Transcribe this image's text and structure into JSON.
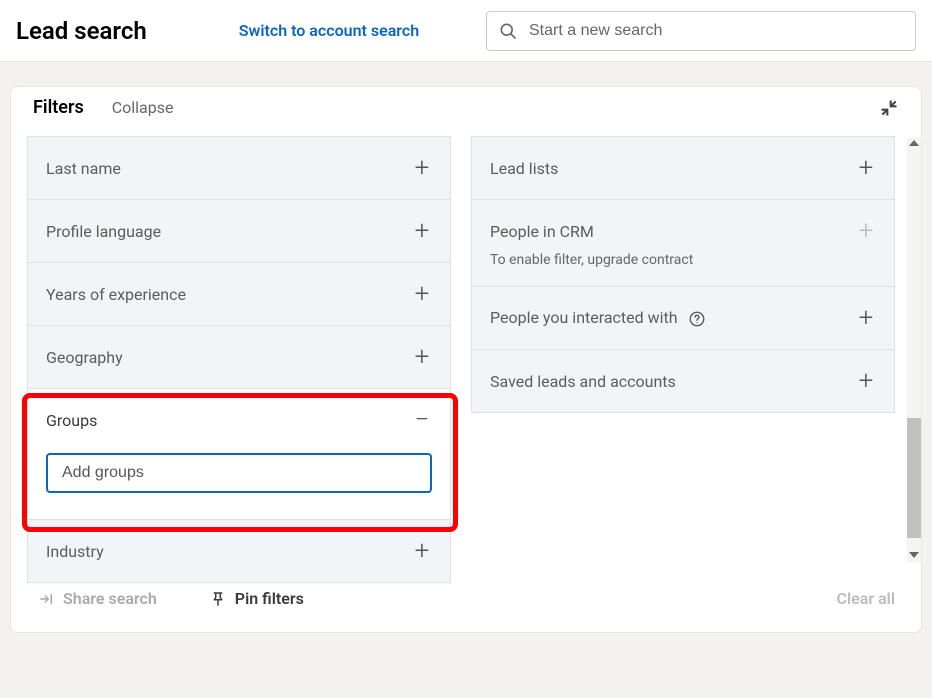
{
  "header": {
    "title": "Lead search",
    "switch_link": "Switch to account search",
    "search_placeholder": "Start a new search"
  },
  "filters_panel": {
    "title": "Filters",
    "collapse_label": "Collapse"
  },
  "left_filters": {
    "last_name": "Last name",
    "profile_language": "Profile language",
    "years_experience": "Years of experience",
    "geography": "Geography",
    "groups": "Groups",
    "groups_placeholder": "Add groups",
    "industry": "Industry"
  },
  "right_filters": {
    "lead_lists": "Lead lists",
    "people_crm": "People in CRM",
    "people_crm_sub": "To enable filter, upgrade contract",
    "people_interacted": "People you interacted with",
    "saved_leads": "Saved leads and accounts"
  },
  "footer": {
    "share": "Share search",
    "pin": "Pin filters",
    "clear": "Clear all"
  }
}
